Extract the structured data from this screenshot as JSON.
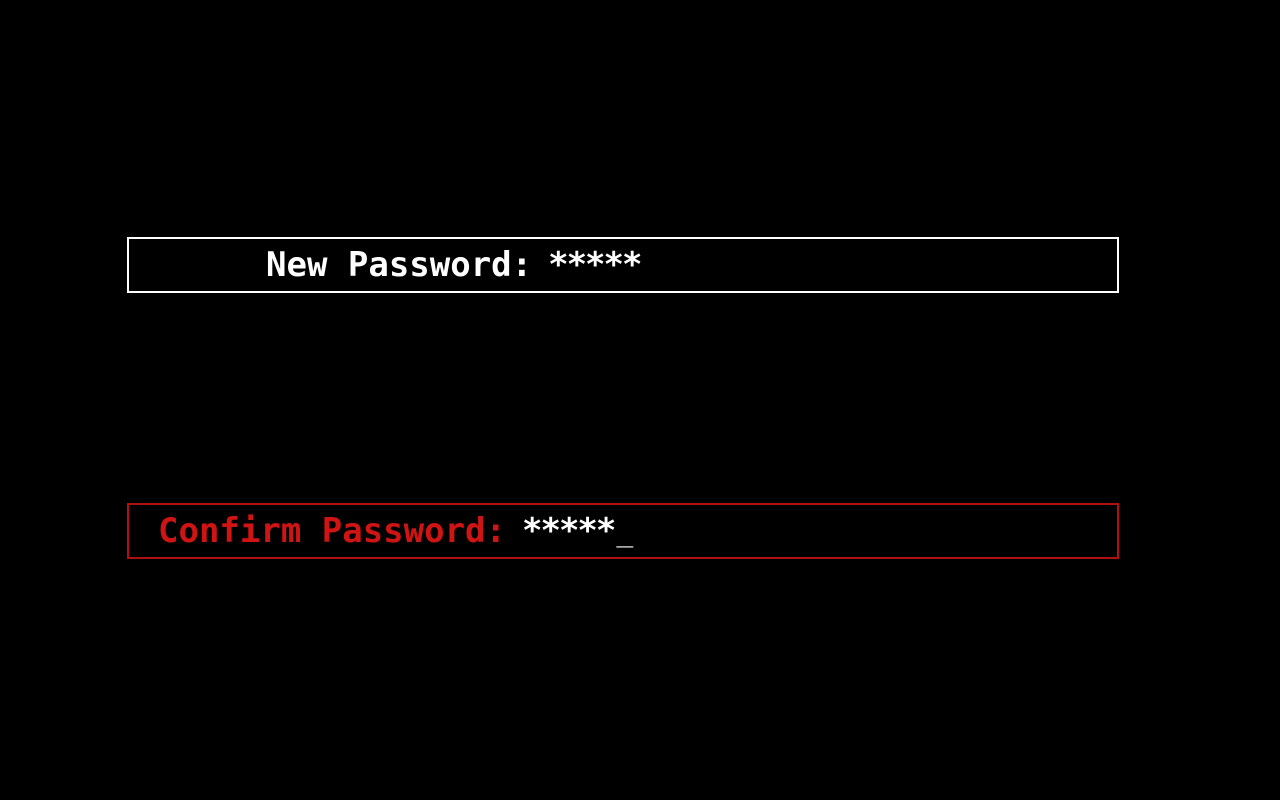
{
  "new_password": {
    "label": "New Password:",
    "value": "*****",
    "border_color": "#ffffff",
    "label_color": "#ffffff"
  },
  "confirm_password": {
    "label": "Confirm Password:",
    "value": "*****",
    "cursor": "_",
    "border_color": "#b01010",
    "label_color": "#d01414",
    "focused": true
  },
  "colors": {
    "background": "#000000",
    "value_text": "#ffffff"
  }
}
